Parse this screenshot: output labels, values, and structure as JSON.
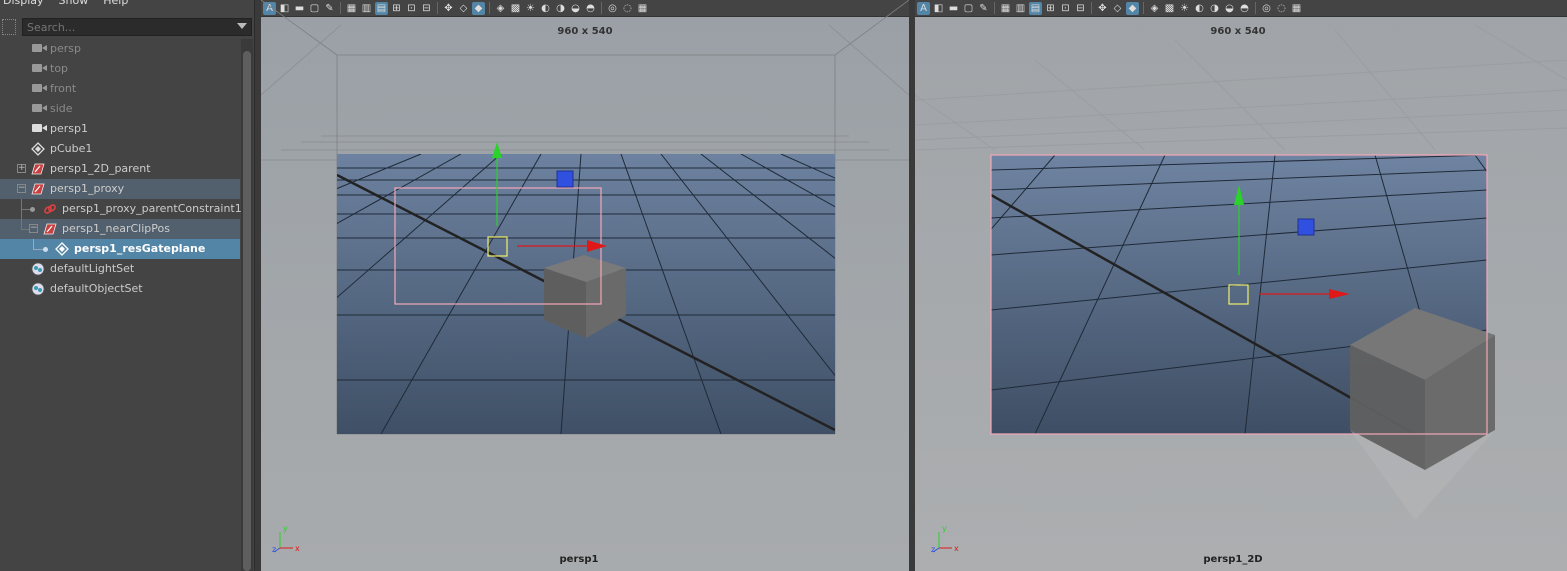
{
  "outliner": {
    "menu": [
      "Display",
      "Show",
      "Help"
    ],
    "search_placeholder": "Search...",
    "items": [
      {
        "label": "persp",
        "icon": "camera-icon"
      },
      {
        "label": "top",
        "icon": "camera-icon"
      },
      {
        "label": "front",
        "icon": "camera-icon"
      },
      {
        "label": "side",
        "icon": "camera-icon"
      },
      {
        "label": "persp1",
        "icon": "camera-icon"
      },
      {
        "label": "pCube1",
        "icon": "mesh-icon"
      },
      {
        "label": "persp1_2D_parent",
        "icon": "transform-icon"
      },
      {
        "label": "persp1_proxy",
        "icon": "transform-icon"
      },
      {
        "label": "persp1_proxy_parentConstraint1",
        "icon": "constraint-icon"
      },
      {
        "label": "persp1_nearClipPos",
        "icon": "transform-icon"
      },
      {
        "label": "persp1_resGateplane",
        "icon": "mesh-icon"
      },
      {
        "label": "defaultLightSet",
        "icon": "set-icon"
      },
      {
        "label": "defaultObjectSet",
        "icon": "set-icon"
      }
    ]
  },
  "viewports": [
    {
      "resolution": "960 x 540",
      "camera": "persp1"
    },
    {
      "resolution": "960 x 540",
      "camera": "persp1_2D"
    }
  ],
  "toolbar_icons": [
    "select-camera-icon",
    "camera-attributes-icon",
    "bookmark-icon",
    "image-plane-icon",
    "grease-pencil-icon",
    "gate-mask-icon",
    "film-gate-icon",
    "resolution-gate-icon",
    "field-chart-icon",
    "safe-action-icon",
    "safe-title-icon",
    "pan-zoom-icon",
    "wireframe-icon",
    "smooth-shade-icon",
    "default-material-icon",
    "textured-icon",
    "lights-icon",
    "shadows-icon",
    "ambient-occlusion-icon",
    "motion-blur-icon",
    "anti-alias-icon",
    "isolate-icon",
    "xray-icon",
    "grid-icon"
  ],
  "colors": {
    "selected_row": "#5285a6",
    "grid_plane": "#5a6e86",
    "manipulator_x": "#e02020",
    "manipulator_y": "#20d020",
    "manipulator_z": "#3050e0",
    "res_gate": "#ffb0c0"
  }
}
